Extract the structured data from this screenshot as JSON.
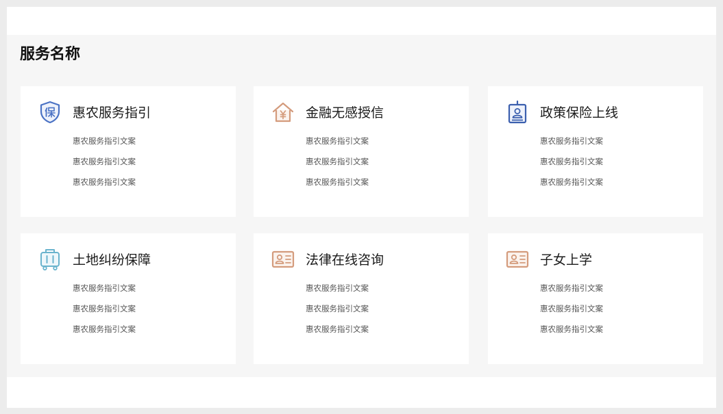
{
  "section": {
    "title": "服务名称"
  },
  "cards": [
    {
      "title": "惠农服务指引",
      "icon": "insurance-shield-icon",
      "icon_color": "#4a72c4",
      "lines": [
        "惠农服务指引文案",
        "惠农服务指引文案",
        "惠农服务指引文案"
      ]
    },
    {
      "title": "金融无感授信",
      "icon": "house-yen-icon",
      "icon_color": "#d49b7c",
      "lines": [
        "惠农服务指引文案",
        "惠农服务指引文案",
        "惠农服务指引文案"
      ]
    },
    {
      "title": "政策保险上线",
      "icon": "badge-card-icon",
      "icon_color": "#3b5fae",
      "lines": [
        "惠农服务指引文案",
        "惠农服务指引文案",
        "惠农服务指引文案"
      ]
    },
    {
      "title": "土地纠纷保障",
      "icon": "luggage-cart-icon",
      "icon_color": "#69b3cd",
      "lines": [
        "惠农服务指引文案",
        "惠农服务指引文案",
        "惠农服务指引文案"
      ]
    },
    {
      "title": "法律在线咨询",
      "icon": "id-card-icon",
      "icon_color": "#d49b7c",
      "lines": [
        "惠农服务指引文案",
        "惠农服务指引文案",
        "惠农服务指引文案"
      ]
    },
    {
      "title": "子女上学",
      "icon": "id-card-icon",
      "icon_color": "#d49b7c",
      "lines": [
        "惠农服务指引文案",
        "惠农服务指引文案",
        "惠农服务指引文案"
      ]
    }
  ]
}
